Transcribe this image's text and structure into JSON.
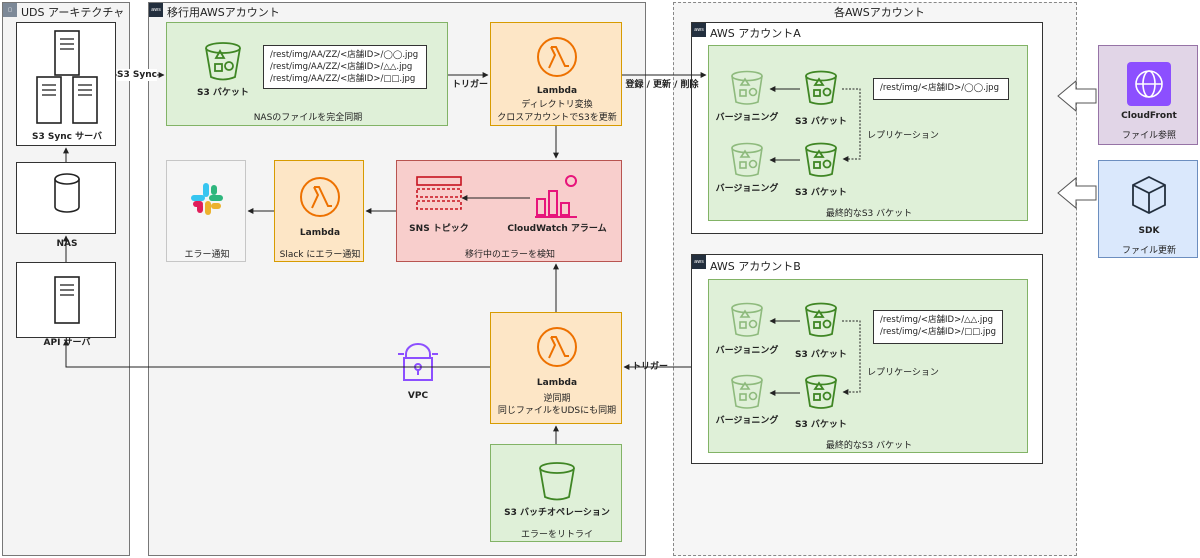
{
  "groups": {
    "uds": {
      "title": "UDS アーキテクチャ"
    },
    "migration": {
      "title": "移行用AWSアカウント"
    },
    "accounts": {
      "title": "各AWSアカウント"
    },
    "account_a": {
      "title": "AWS アカウントA"
    },
    "account_b": {
      "title": "AWS アカウントB"
    }
  },
  "uds": {
    "s3sync_server": "S3 Sync サーバ",
    "nas": "NAS",
    "api_server": "API サーバ"
  },
  "edges": {
    "s3_sync": "S3 Sync",
    "trigger_1": "トリガー",
    "register": "登録 / 更新 / 削除",
    "trigger_2": "トリガー",
    "replication_a": "レプリケーション",
    "replication_b": "レプリケーション"
  },
  "migration": {
    "s3_bucket": "S3 バケット",
    "nas_sync_caption": "NASのファイルを完全同期",
    "paths": [
      "/rest/img/AA/ZZ/<店舗ID>/◯◯.jpg",
      "/rest/img/AA/ZZ/<店舗ID>/△△.jpg",
      "/rest/img/AA/ZZ/<店舗ID>/□□.jpg"
    ],
    "lambda1": {
      "name": "Lambda",
      "desc1": "ディレクトリ変換",
      "desc2": "クロスアカウントでS3を更新"
    },
    "sns": "SNS トピック",
    "cloudwatch": "CloudWatch アラーム",
    "error_detect_caption": "移行中のエラーを検知",
    "lambda2": {
      "name": "Lambda",
      "desc": "Slack にエラー通知"
    },
    "error_notify": "エラー通知",
    "vpc": "VPC",
    "lambda3": {
      "name": "Lambda",
      "desc1": "逆同期",
      "desc2": "同じファイルをUDSにも同期"
    },
    "batch": {
      "name": "S3 バッチオペレーション",
      "desc": "エラーをリトライ"
    }
  },
  "account_a": {
    "versioning": "バージョニング",
    "bucket": "S3 バケット",
    "replication": "レプリケーション",
    "path": "/rest/img/<店舗ID>/◯◯.jpg",
    "caption": "最終的なS3 バケット"
  },
  "account_b": {
    "versioning": "バージョニング",
    "bucket": "S3 バケット",
    "replication": "レプリケーション",
    "paths": [
      "/rest/img/<店舗ID>/△△.jpg",
      "/rest/img/<店舗ID>/□□.jpg"
    ],
    "caption": "最終的なS3 バケット"
  },
  "right": {
    "cloudfront": {
      "name": "CloudFront",
      "desc": "ファイル参照"
    },
    "sdk": {
      "name": "SDK",
      "desc": "ファイル更新"
    }
  },
  "colors": {
    "green_fill": "#dff0d8",
    "orange_fill": "#fde6c6",
    "red_fill": "#f8cecc",
    "purple_fill": "#e1d5e7",
    "blue_fill": "#dae8fc",
    "s3_green": "#3f8624",
    "lambda_orange": "#ed7100",
    "pink_cw": "#e7157b",
    "vpc_purple": "#8c4fff"
  }
}
